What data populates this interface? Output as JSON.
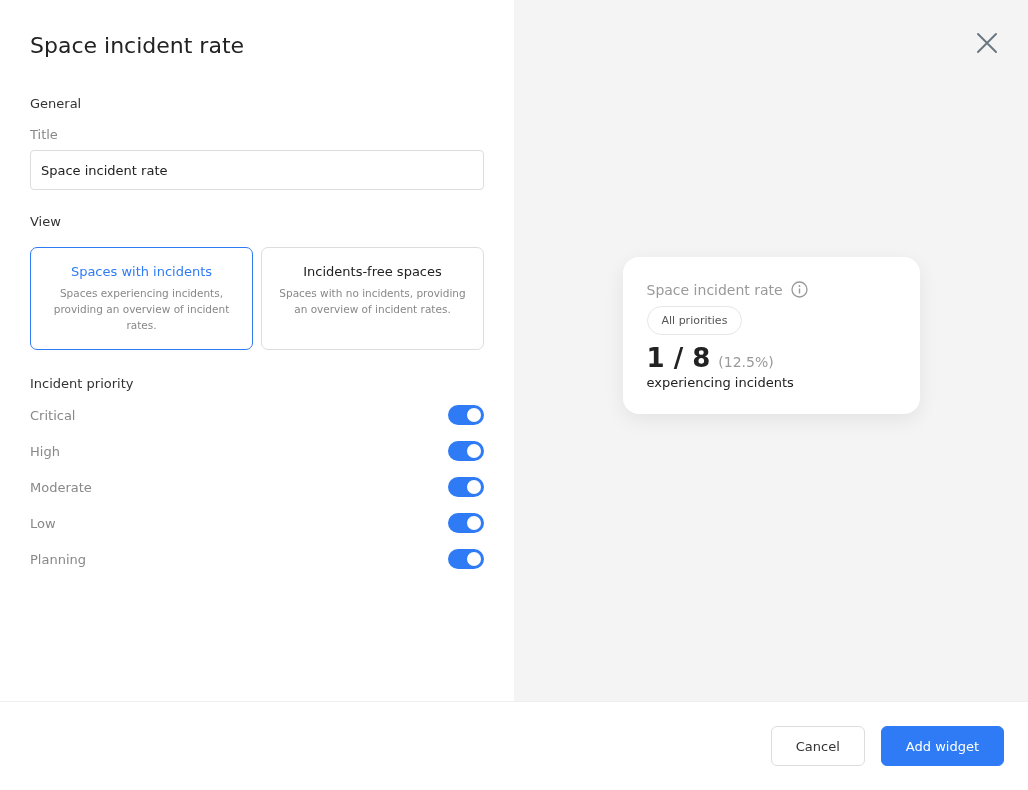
{
  "dialog": {
    "title": "Space incident rate"
  },
  "general": {
    "heading": "General",
    "title_field": {
      "label": "Title",
      "value": "Space incident rate"
    }
  },
  "view": {
    "heading": "View",
    "options": [
      {
        "title": "Spaces with incidents",
        "description": "Spaces experiencing incidents, providing an overview of incident rates.",
        "selected": true
      },
      {
        "title": "Incidents-free spaces",
        "description": "Spaces with no incidents, providing an overview of incident rates.",
        "selected": false
      }
    ]
  },
  "priority": {
    "heading": "Incident priority",
    "items": [
      {
        "label": "Critical",
        "on": true
      },
      {
        "label": "High",
        "on": true
      },
      {
        "label": "Moderate",
        "on": true
      },
      {
        "label": "Low",
        "on": true
      },
      {
        "label": "Planning",
        "on": true
      }
    ]
  },
  "preview": {
    "title": "Space incident rate",
    "chip": "All priorities",
    "value": "1 / 8",
    "percent": "(12.5%)",
    "caption": "experiencing incidents"
  },
  "buttons": [
    {
      "label": "Cancel",
      "kind": "secondary"
    },
    {
      "label": "Add widget",
      "kind": "primary"
    }
  ]
}
